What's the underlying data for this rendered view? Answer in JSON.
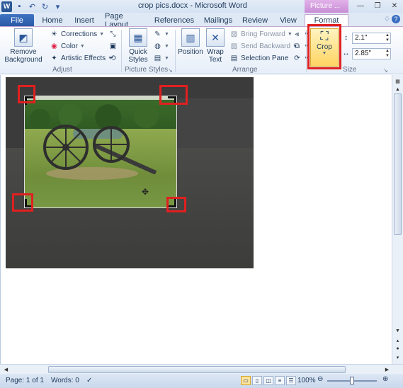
{
  "app": {
    "title": "crop pics.docx - Microsoft Word",
    "logo_letter": "W",
    "context_tab_header": "Picture ...",
    "accent": "#2b579a",
    "context_accent": "#c98ed6"
  },
  "qat": {
    "save_icon": "save-icon",
    "undo_icon": "undo-icon",
    "redo_icon": "redo-icon",
    "customize_icon": "customize-qat-icon"
  },
  "window_controls": [
    "minimize-icon",
    "restore-icon",
    "close-icon"
  ],
  "tabs": [
    "File",
    "Home",
    "Insert",
    "Page Layout",
    "References",
    "Mailings",
    "Review",
    "View",
    "Format"
  ],
  "ribbon": {
    "adjust": {
      "label": "Adjust",
      "remove_background": "Remove Background",
      "corrections": "Corrections",
      "color": "Color",
      "artistic_effects": "Artistic Effects"
    },
    "picture_styles": {
      "label": "Picture Styles",
      "quick_styles": "Quick Styles"
    },
    "arrange": {
      "label": "Arrange",
      "position": "Position",
      "wrap_text": "Wrap Text",
      "bring_forward": "Bring Forward",
      "send_backward": "Send Backward",
      "selection_pane": "Selection Pane"
    },
    "size": {
      "label": "Size",
      "crop": "Crop",
      "height": "2.1\"",
      "width": "2.85\""
    }
  },
  "statusbar": {
    "page": "Page: 1 of 1",
    "words": "Words: 0",
    "zoom": "100%"
  }
}
